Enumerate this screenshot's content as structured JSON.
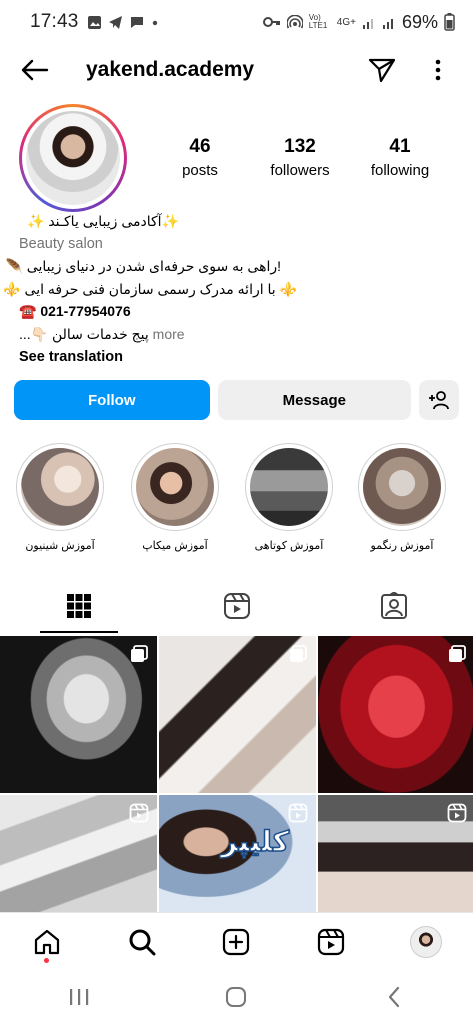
{
  "status": {
    "time": "17:43",
    "battery": "69%",
    "net_label": "Vo) LTE1",
    "net_type": "4G+"
  },
  "header": {
    "username": "yakend.academy"
  },
  "profile": {
    "stats": [
      {
        "value": "46",
        "label": "posts"
      },
      {
        "value": "132",
        "label": "followers"
      },
      {
        "value": "41",
        "label": "following"
      }
    ]
  },
  "bio": {
    "name": "✨آکادمی زیبایی  یاکـند ✨",
    "category": "Beauty salon",
    "line1": "!راهی به سوی حرفه‌ای شدن در دنیای زیبایی 🪶",
    "line2": "⚜️ با ارائه مدرک رسمی سازمان فنی حرفه ایی ⚜️",
    "phone": "☎️ 021-77954076",
    "line4": "پیج خدمات سالن 👇🏻...",
    "more": " more",
    "translate": "See translation"
  },
  "actions": {
    "follow": "Follow",
    "message": "Message"
  },
  "highlights": [
    {
      "label": "آموزش شینیون"
    },
    {
      "label": "آموزش میکاپ"
    },
    {
      "label": "آموزش کوتاهی"
    },
    {
      "label": "آموزش رنگمو"
    }
  ],
  "grid": {
    "overlay_text": "کلیپر"
  },
  "colors": {
    "accent": "#0095f6",
    "secondary_button": "#efefef",
    "muted_text": "#737373",
    "notification_dot": "#ff3040"
  },
  "icons": {
    "back": "arrow-left-icon",
    "send": "direct-send-icon",
    "more": "more-vertical-icon",
    "add_user": "add-person-icon",
    "grid_tab": "grid-icon",
    "reels_tab": "reels-icon",
    "tagged_tab": "tagged-icon",
    "home": "home-icon",
    "search": "search-icon",
    "create": "create-icon",
    "reels": "reels-icon",
    "profile": "avatar"
  }
}
